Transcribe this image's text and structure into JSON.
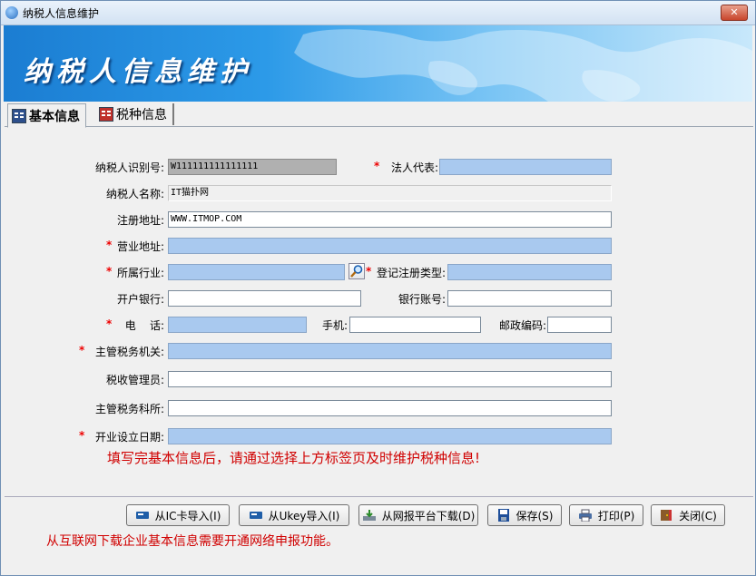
{
  "window": {
    "title": "纳税人信息维护",
    "close_icon": "close-icon"
  },
  "banner": {
    "title": "纳税人信息维护"
  },
  "tabs": [
    {
      "label": "基本信息",
      "active": true
    },
    {
      "label": "税种信息",
      "active": false
    }
  ],
  "form": {
    "taxpayer_id": {
      "label": "纳税人识别号:",
      "value": "W111111111111111"
    },
    "legal_rep": {
      "label": "法人代表:",
      "value": ""
    },
    "taxpayer_name": {
      "label": "纳税人名称:",
      "value": "IT猫扑网"
    },
    "reg_address": {
      "label": "注册地址:",
      "value": "WWW.ITMOP.COM"
    },
    "business_address": {
      "label": "营业地址:",
      "value": ""
    },
    "industry": {
      "label": "所属行业:",
      "value": ""
    },
    "reg_type": {
      "label": "登记注册类型:",
      "value": ""
    },
    "bank": {
      "label": "开户银行:",
      "value": ""
    },
    "bank_account": {
      "label": "银行账号:",
      "value": ""
    },
    "phone": {
      "label": "电    话:",
      "value": ""
    },
    "mobile": {
      "label": "手机:",
      "value": ""
    },
    "postcode": {
      "label": "邮政编码:",
      "value": ""
    },
    "tax_authority": {
      "label": "主管税务机关:",
      "value": ""
    },
    "tax_officer": {
      "label": "税收管理员:",
      "value": ""
    },
    "tax_section": {
      "label": "主管税务科所:",
      "value": ""
    },
    "open_date": {
      "label": "开业设立日期:",
      "value": ""
    },
    "required_mark": "*"
  },
  "hint": "填写完基本信息后，请通过选择上方标签页及时维护税种信息!",
  "buttons": {
    "ic_import": "从IC卡导入(I)",
    "ukey_import": "从Ukey导入(I)",
    "platform_download": "从网报平台下载(D)",
    "save": "保存(S)",
    "print": "打印(P)",
    "close": "关闭(C)"
  },
  "footer_note": "从互联网下载企业基本信息需要开通网络申报功能。",
  "colors": {
    "required_field": "#a9c9ef",
    "hint_text": "#d00000",
    "banner": "#2c9ae8"
  }
}
